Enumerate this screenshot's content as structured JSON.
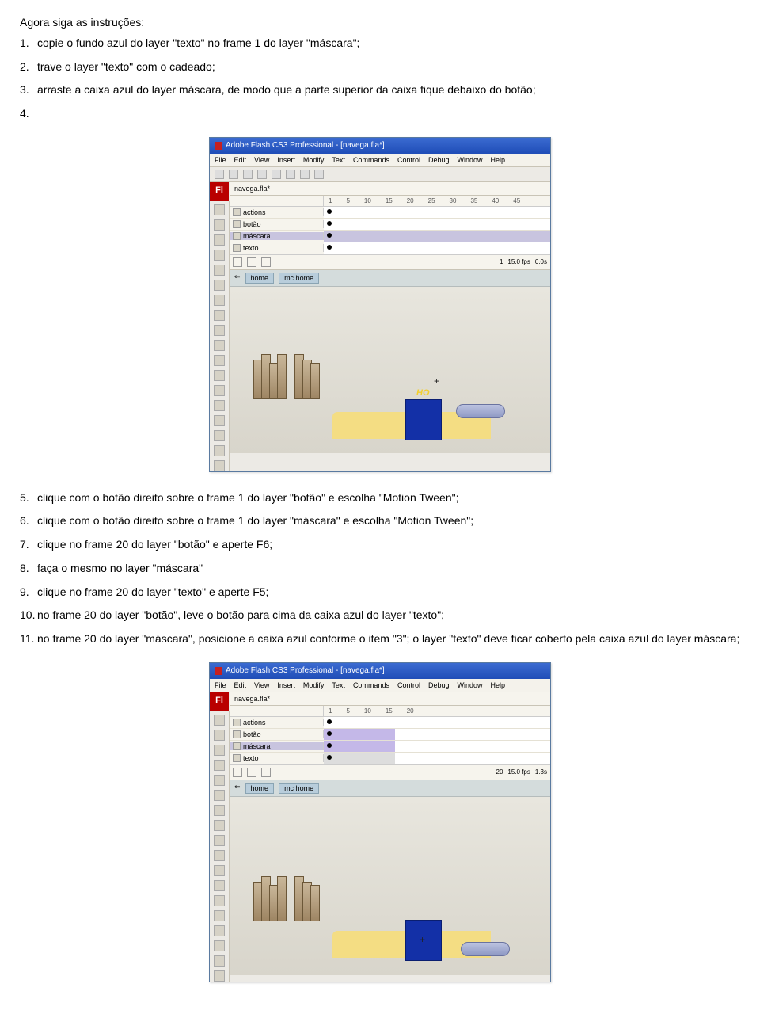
{
  "heading": "Agora siga as instruções:",
  "items": [
    {
      "num": "1.",
      "text": "copie o fundo azul do layer \"texto\" no frame 1 do layer \"máscara\";"
    },
    {
      "num": "2.",
      "text": "trave o layer \"texto\" com o cadeado;"
    },
    {
      "num": "3.",
      "text": "arraste a caixa azul do layer máscara, de modo que a parte superior da caixa fique debaixo do botão;"
    },
    {
      "num": "4.",
      "text": ""
    },
    {
      "num": "5.",
      "text": "clique com o botão direito sobre o frame 1 do layer \"botão\" e escolha \"Motion Tween\";"
    },
    {
      "num": "6.",
      "text": "clique com o botão direito sobre o frame 1 do layer \"máscara\" e escolha \"Motion Tween\";"
    },
    {
      "num": "7.",
      "text": "clique no frame 20 do layer \"botão\" e aperte F6;"
    },
    {
      "num": "8.",
      "text": "faça o mesmo no layer \"máscara\""
    },
    {
      "num": "9.",
      "text": "clique no frame 20 do layer \"texto\" e aperte F5;"
    },
    {
      "num": "10.",
      "text": "no frame 20 do layer \"botão\", leve o botão para cima da caixa azul do layer \"texto\";"
    },
    {
      "num": "11.",
      "text": "no frame 20 do layer \"máscara\", posicione a caixa azul conforme o item \"3\"; o layer \"texto\" deve ficar coberto pela caixa azul do layer máscara;"
    }
  ],
  "flash": {
    "title": "Adobe Flash CS3 Professional - [navega.fla*]",
    "menu": [
      "File",
      "Edit",
      "View",
      "Insert",
      "Modify",
      "Text",
      "Commands",
      "Control",
      "Debug",
      "Window",
      "Help"
    ],
    "fl_label": "Fl",
    "doc_tab": "navega.fla*",
    "ruler_marks": [
      "1",
      "5",
      "10",
      "15",
      "20",
      "25",
      "30",
      "35",
      "40",
      "45"
    ],
    "layers": [
      "actions",
      "botão",
      "máscara",
      "texto"
    ],
    "status1": {
      "frame": "1",
      "fps": "15.0 fps",
      "time": "0.0s"
    },
    "status2": {
      "frame": "20",
      "fps": "15.0 fps",
      "time": "1.3s"
    },
    "breadcrumb": [
      "home",
      "mc home"
    ],
    "ho_text": "HO"
  }
}
